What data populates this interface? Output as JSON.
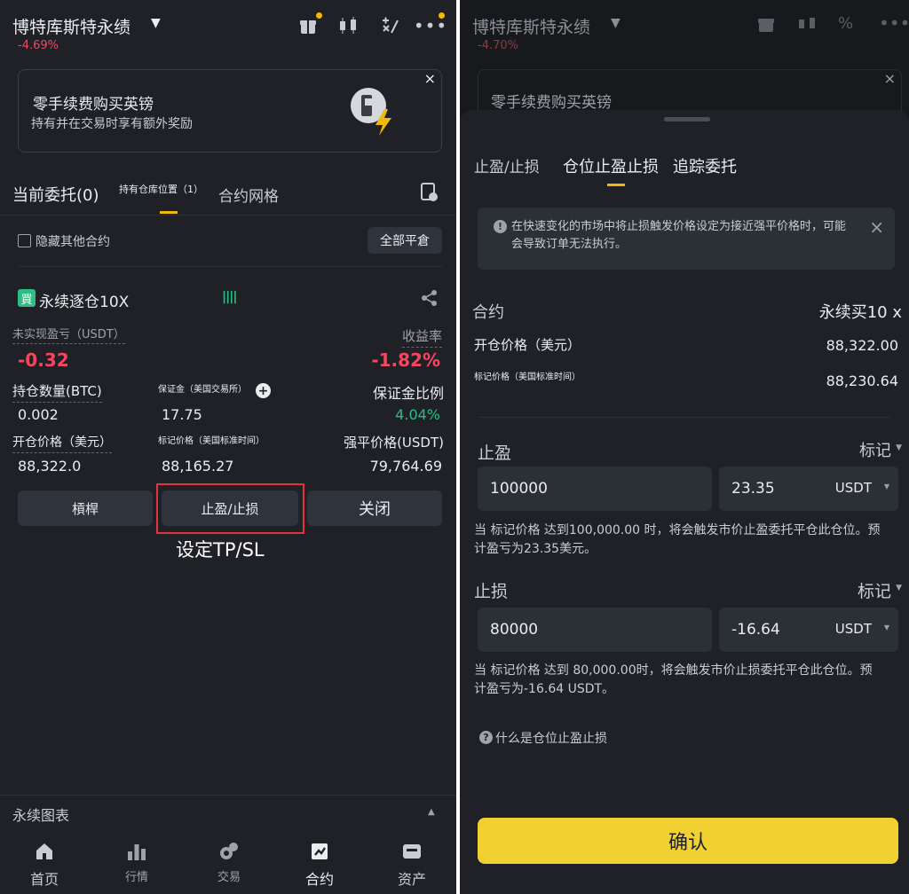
{
  "left": {
    "header": {
      "title": "博特库斯特永绩",
      "change": "-4.69%"
    },
    "promo": {
      "title": "零手续费购买英镑",
      "subtitle": "持有并在交易时享有额外奖励",
      "close": "×"
    },
    "tabs": [
      {
        "label": "当前委托(0)"
      },
      {
        "label": "持有仓库位置（1）"
      },
      {
        "label": "合约网格"
      }
    ],
    "hide_other": "隐藏其他合约",
    "close_all": "全部平倉",
    "position": {
      "badge": "買",
      "name": "永续逐仓10X",
      "bars": "||||",
      "pnl_label": "未实现盈亏（USDT）",
      "pnl_value": "-0.32",
      "roe_label": "收益率",
      "roe_value": "-1.82%",
      "size_label": "持仓数量(BTC)",
      "size_value": "0.002",
      "margin_label": "保证金（美国交易所）",
      "margin_value": "17.75",
      "margin_ratio_label": "保证金比例",
      "margin_ratio_value": "4.04%",
      "entry_label": "开仓价格（美元）",
      "entry_value": "88,322.0",
      "mark_label": "标记价格（美国标准时间）",
      "mark_value": "88,165.27",
      "liq_label": "强平价格(USDT)",
      "liq_value": "79,764.69"
    },
    "buttons": {
      "leverage": "槓桿",
      "tpsl": "止盈/止损",
      "close": "关闭"
    },
    "annotation": "设定TP/SL",
    "chart_section": "永续图表",
    "nav": [
      {
        "label": "首页",
        "icon": "home-icon"
      },
      {
        "label": "行情",
        "icon": "markets-icon"
      },
      {
        "label": "交易",
        "icon": "trade-icon"
      },
      {
        "label": "合约",
        "icon": "futures-icon"
      },
      {
        "label": "资产",
        "icon": "wallet-icon"
      }
    ]
  },
  "right": {
    "header": {
      "title": "博特库斯特永绩",
      "change": "-4.70%"
    },
    "promo_title": "零手续费购买英镑",
    "tabs": [
      {
        "label": "止盈/止损"
      },
      {
        "label": "仓位止盈止损"
      },
      {
        "label": "追踪委托"
      }
    ],
    "warning": "在快速变化的市场中将止损触发价格设定为接近强平价格时，可能会导致订单无法执行。",
    "contract_label": "合约",
    "contract_value": "永续买10 x",
    "entry_label": "开仓价格（美元）",
    "entry_value": "88,322.00",
    "mark_label": "标记价格（美国标准时间）",
    "mark_value": "88,230.64",
    "tp": {
      "label": "止盈",
      "type": "标记",
      "price": "100000",
      "amount": "23.35",
      "unit": "USDT",
      "desc": "当 标记价格 达到100,000.00 时，将会触发市价止盈委托平仓此仓位。预计盈亏为23.35美元。"
    },
    "sl": {
      "label": "止损",
      "type": "标记",
      "price": "80000",
      "amount": "-16.64",
      "unit": "USDT",
      "desc": "当 标记价格 达到 80,000.00时，将会触发市价止损委托平仓此仓位。预计盈亏为-16.64 USDT。"
    },
    "help": "什么是仓位止盈止损",
    "confirm": "确认"
  },
  "colors": {
    "accent": "#f0b90b",
    "red": "#f6465d",
    "green": "#2ebd85",
    "bg": "#1f2127"
  }
}
